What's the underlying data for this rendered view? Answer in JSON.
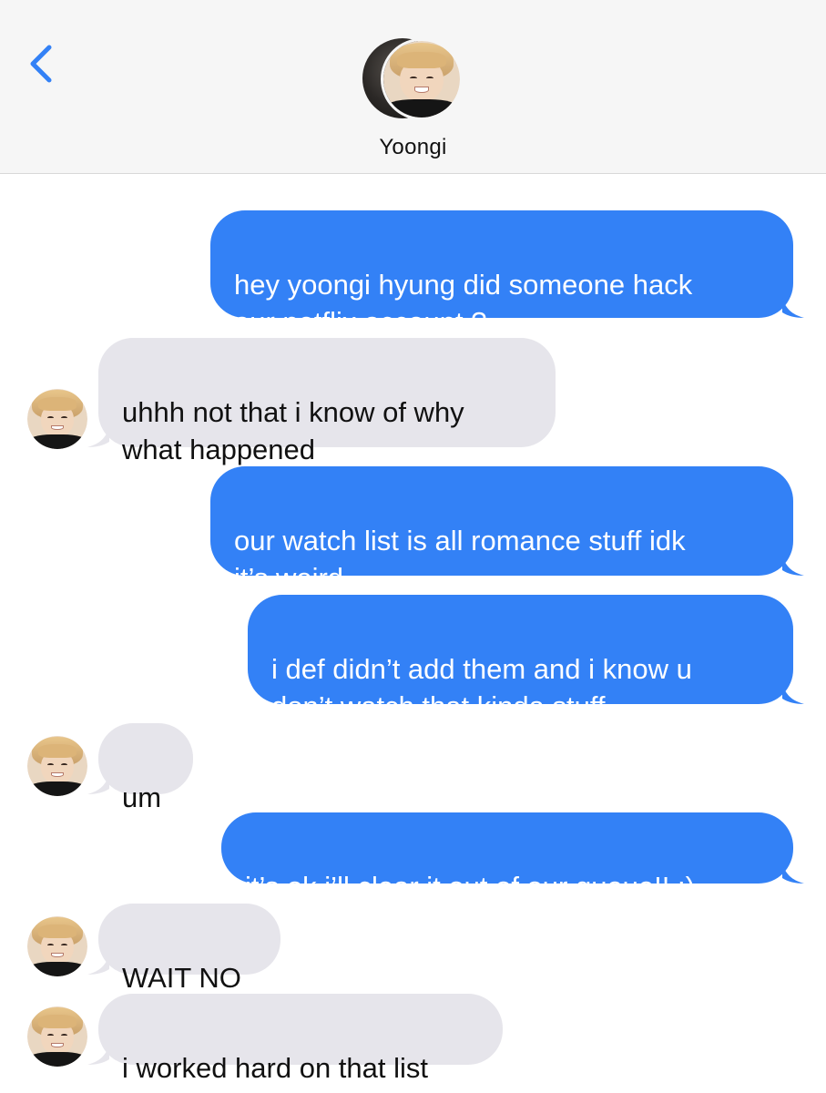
{
  "header": {
    "back_icon": "chevron-left-icon",
    "contact_name": "Yoongi",
    "accent_color": "#3381f6"
  },
  "messages": [
    {
      "direction": "sent",
      "text": "hey yoongi hyung did someone hack\nour netflix account ?"
    },
    {
      "direction": "received",
      "text": "uhhh not that i know of why\nwhat happened"
    },
    {
      "direction": "sent",
      "text": "our watch list is all romance stuff idk\nit’s weird"
    },
    {
      "direction": "sent",
      "text": "i def didn’t add them and i know u\ndon’t watch that kinda stuff"
    },
    {
      "direction": "received",
      "text": "um"
    },
    {
      "direction": "sent",
      "text": "it’s ok i’ll clear it out of our queue!! :)"
    },
    {
      "direction": "received",
      "text": "WAIT NO"
    },
    {
      "direction": "received",
      "text": "i worked hard on that list"
    }
  ],
  "colors": {
    "sent_bubble": "#3381f6",
    "received_bubble": "#e6e5eb",
    "header_bg": "#f6f6f6"
  }
}
